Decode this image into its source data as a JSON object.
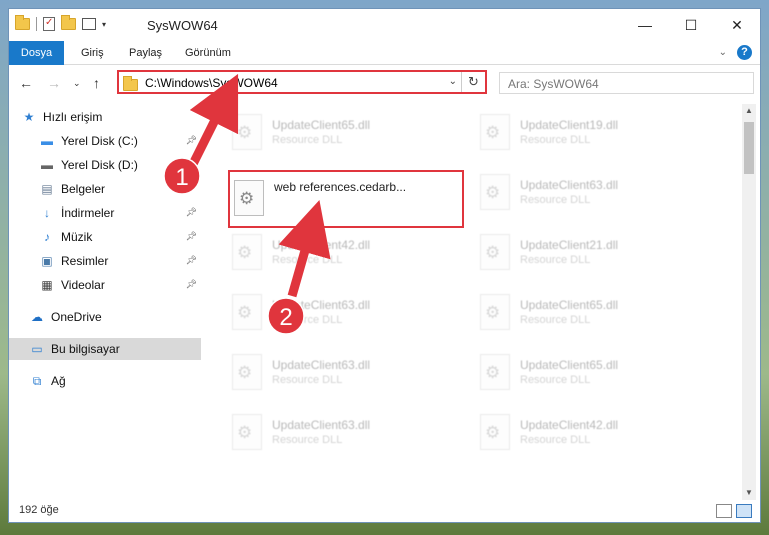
{
  "window": {
    "title": "SysWOW64"
  },
  "ribbon": {
    "tabs": [
      {
        "label": "Dosya",
        "active": true
      },
      {
        "label": "Giriş"
      },
      {
        "label": "Paylaş"
      },
      {
        "label": "Görünüm"
      }
    ]
  },
  "nav": {
    "address": "C:\\Windows\\SysWOW64",
    "search_placeholder": "Ara: SysWOW64"
  },
  "sidebar": {
    "items": [
      {
        "label": "Hızlı erişim",
        "icon": "star-icon",
        "pinned": false
      },
      {
        "label": "Yerel Disk (C:)",
        "icon": "disk-icon",
        "pinned": true
      },
      {
        "label": "Yerel Disk (D:)",
        "icon": "disk-icon",
        "pinned": true
      },
      {
        "label": "Belgeler",
        "icon": "documents-icon",
        "pinned": true
      },
      {
        "label": "İndirmeler",
        "icon": "download-icon",
        "pinned": true
      },
      {
        "label": "Müzik",
        "icon": "music-icon",
        "pinned": true
      },
      {
        "label": "Resimler",
        "icon": "pictures-icon",
        "pinned": true
      },
      {
        "label": "Videolar",
        "icon": "video-icon",
        "pinned": true
      },
      {
        "label": "OneDrive",
        "icon": "cloud-icon",
        "pinned": false
      },
      {
        "label": "Bu bilgisayar",
        "icon": "computer-icon",
        "pinned": false,
        "selected": true
      },
      {
        "label": "Ağ",
        "icon": "network-icon",
        "pinned": false
      }
    ]
  },
  "files": {
    "left": [
      {
        "name": "UpdateClient65.dll",
        "type": "Resource DLL",
        "faded": true
      },
      {
        "name": "web references.cedarb...",
        "type": "",
        "faded": false,
        "highlighted": true
      },
      {
        "name": "UpdateClient42.dll",
        "type": "Resource DLL",
        "faded": true
      },
      {
        "name": "UpdateClient63.dll",
        "type": "Resource DLL",
        "faded": true
      },
      {
        "name": "UpdateClient63.dll",
        "type": "Resource DLL",
        "faded": true
      },
      {
        "name": "UpdateClient63.dll",
        "type": "Resource DLL",
        "faded": true
      }
    ],
    "right": [
      {
        "name": "UpdateClient19.dll",
        "type": "Resource DLL",
        "faded": true
      },
      {
        "name": "UpdateClient63.dll",
        "type": "Resource DLL",
        "faded": true
      },
      {
        "name": "UpdateClient21.dll",
        "type": "Resource DLL",
        "faded": true
      },
      {
        "name": "UpdateClient65.dll",
        "type": "Resource DLL",
        "faded": true
      },
      {
        "name": "UpdateClient65.dll",
        "type": "Resource DLL",
        "faded": true
      },
      {
        "name": "UpdateClient42.dll",
        "type": "Resource DLL",
        "faded": true
      }
    ]
  },
  "status": {
    "count": "192 öğe"
  },
  "annotations": {
    "step1": "1",
    "step2": "2",
    "accent_color": "#e0353d"
  }
}
